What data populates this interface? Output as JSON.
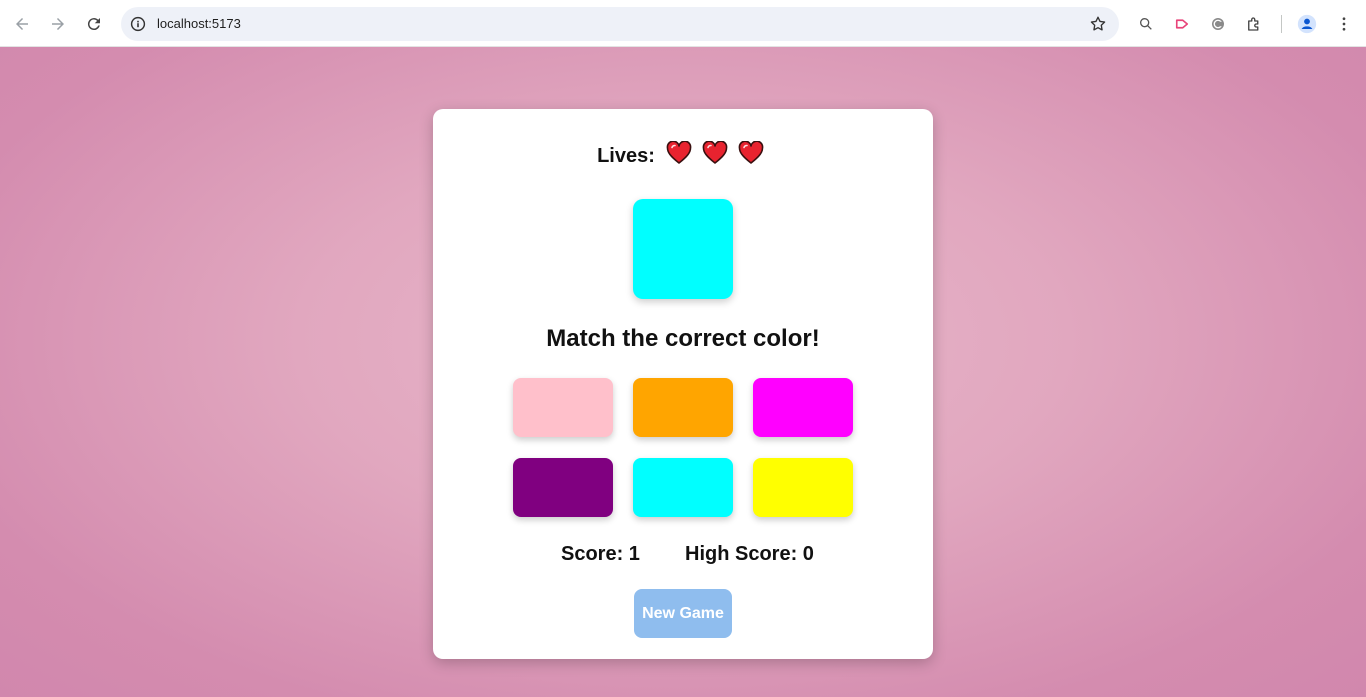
{
  "browser": {
    "url": "localhost:5173"
  },
  "game": {
    "lives_label": "Lives:",
    "lives": 3,
    "target_color": "#00ffff",
    "prompt": "Match the correct color!",
    "options": [
      {
        "color": "#ffc0cb"
      },
      {
        "color": "#ffa500"
      },
      {
        "color": "#ff00ff"
      },
      {
        "color": "#800080"
      },
      {
        "color": "#00ffff"
      },
      {
        "color": "#ffff00"
      }
    ],
    "score_text": "Score: 1",
    "high_score_text": "High Score: 0",
    "new_game_label": "New Game"
  },
  "colors": {
    "heart": "#e8232f",
    "button": "#8fbdee"
  }
}
